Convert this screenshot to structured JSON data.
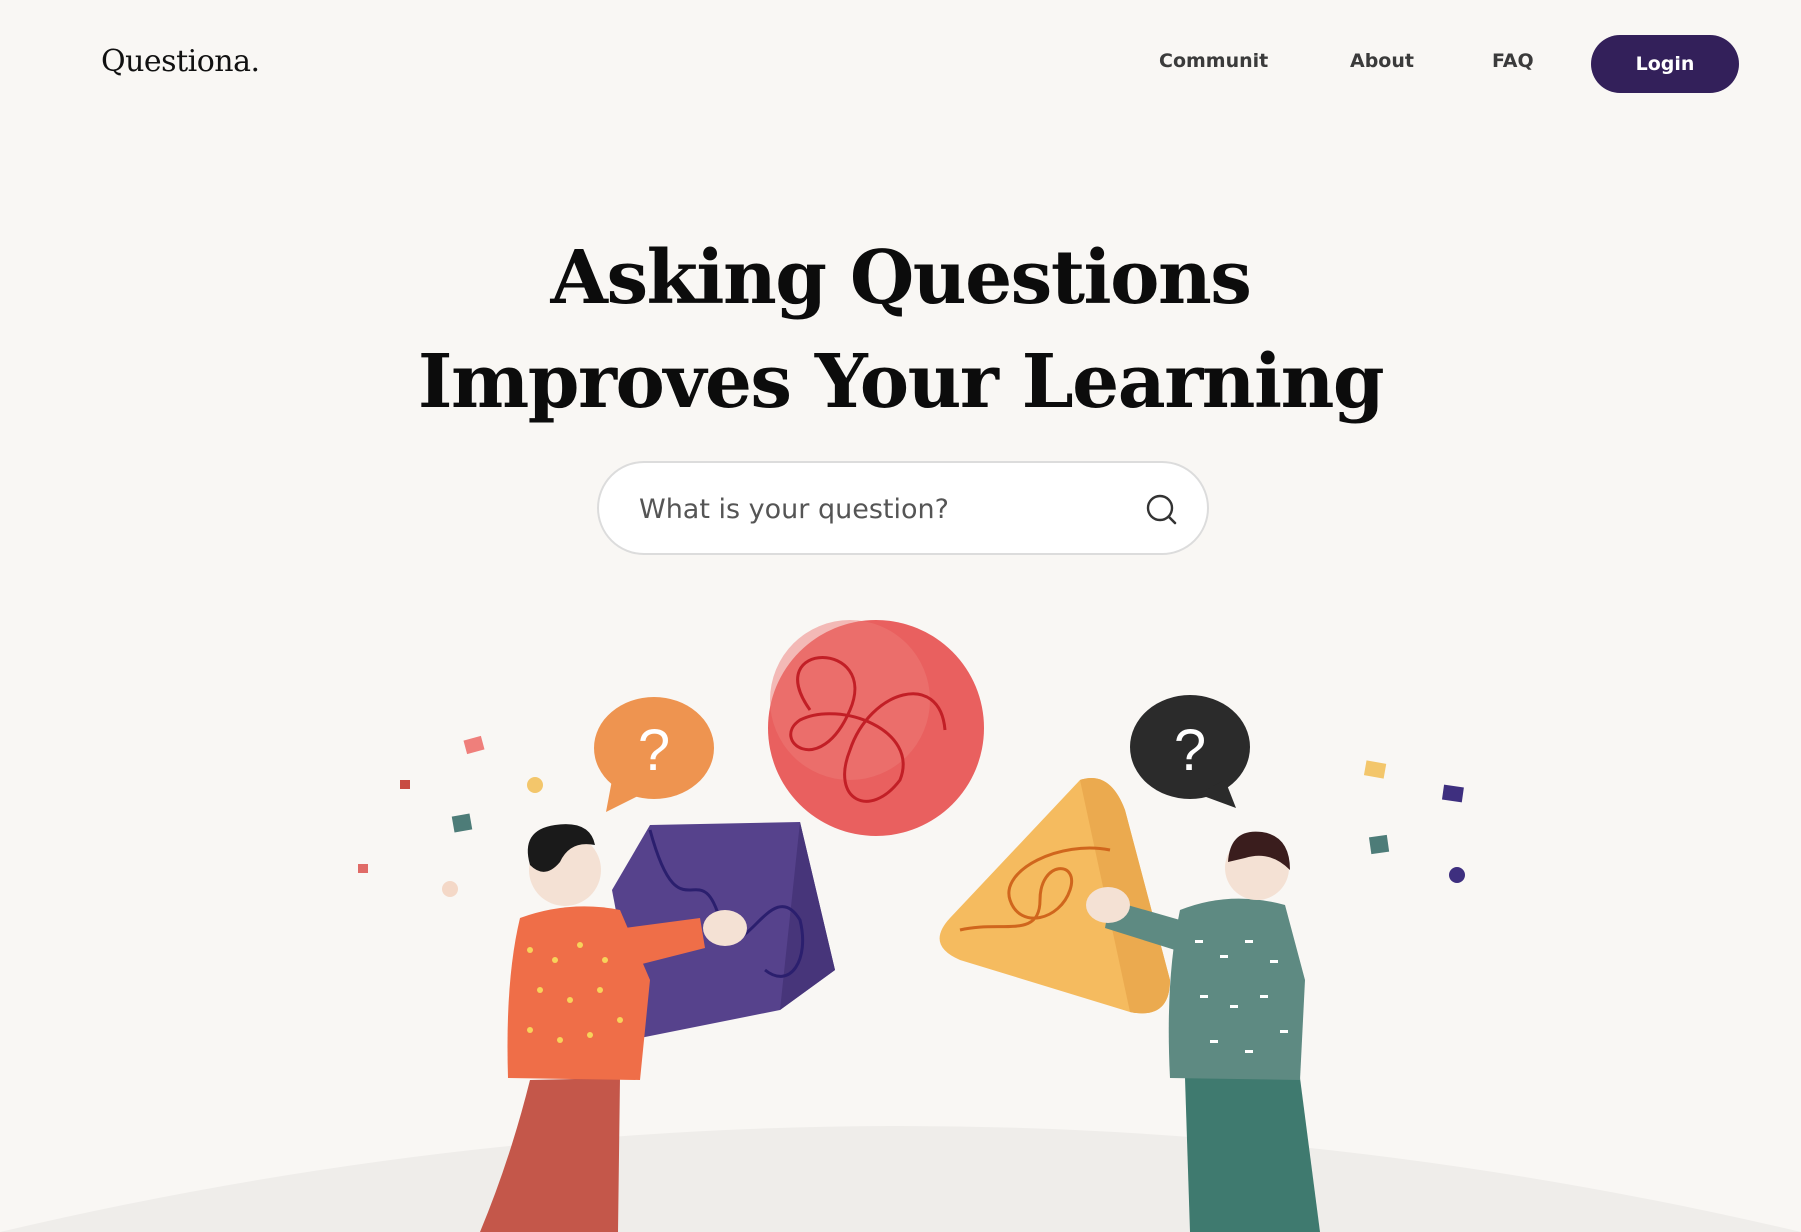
{
  "brand": {
    "logo_text": "Questiona."
  },
  "nav": {
    "items": [
      {
        "label": "Communit"
      },
      {
        "label": "About"
      },
      {
        "label": "FAQ"
      }
    ],
    "login_label": "Login"
  },
  "hero": {
    "headline_line1": "Asking Questions",
    "headline_line2": "Improves Your Learning",
    "search": {
      "placeholder": "What is your question?"
    }
  },
  "illustration": {
    "left_bubble_text": "?",
    "right_bubble_text": "?"
  },
  "colors": {
    "background": "#f9f7f4",
    "accent": "#33205a",
    "orange_bubble": "#ee9450",
    "dark_bubble": "#2b2b2b",
    "purple_cube": "#56428c",
    "red_sphere": "#e9605f",
    "yellow_shape": "#f5bb5f"
  }
}
